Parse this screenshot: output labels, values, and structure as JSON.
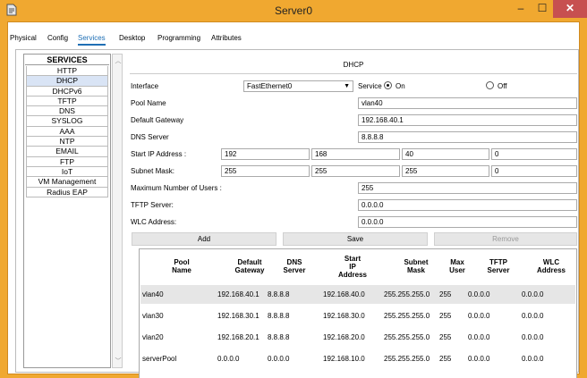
{
  "window": {
    "title": "Server0",
    "min": "–",
    "max": "☐",
    "close": "✕"
  },
  "tabs": [
    "Physical",
    "Config",
    "Services",
    "Desktop",
    "Programming",
    "Attributes"
  ],
  "services": {
    "header": "SERVICES",
    "items": [
      "HTTP",
      "DHCP",
      "DHCPv6",
      "TFTP",
      "DNS",
      "SYSLOG",
      "AAA",
      "NTP",
      "EMAIL",
      "FTP",
      "IoT",
      "VM Management",
      "Radius EAP"
    ],
    "selected": "DHCP"
  },
  "dhcp": {
    "title": "DHCP",
    "interface_label": "Interface",
    "interface_value": "FastEthernet0",
    "service_label": "Service",
    "on_label": "On",
    "off_label": "Off",
    "service_state": "on",
    "pool_name_label": "Pool Name",
    "pool_name": "vlan40",
    "gateway_label": "Default Gateway",
    "gateway": "192.168.40.1",
    "dns_label": "DNS Server",
    "dns": "8.8.8.8",
    "start_ip_label": "Start IP Address :",
    "start_ip": [
      "192",
      "168",
      "40",
      "0"
    ],
    "subnet_label": "Subnet Mask:",
    "subnet": [
      "255",
      "255",
      "255",
      "0"
    ],
    "max_users_label": "Maximum Number of Users :",
    "max_users": "255",
    "tftp_label": "TFTP Server:",
    "tftp": "0.0.0.0",
    "wlc_label": "WLC Address:",
    "wlc": "0.0.0.0",
    "add_label": "Add",
    "save_label": "Save",
    "remove_label": "Remove"
  },
  "table": {
    "headers": [
      [
        "Pool",
        "Name"
      ],
      [
        "Default",
        "Gateway"
      ],
      [
        "DNS",
        "Server"
      ],
      [
        "Start",
        "IP",
        "Address"
      ],
      [
        "Subnet",
        "Mask"
      ],
      [
        "Max",
        "User"
      ],
      [
        "TFTP",
        "Server"
      ],
      [
        "WLC",
        "Address"
      ]
    ],
    "rows": [
      [
        "vlan40",
        "192.168.40.1",
        "8.8.8.8",
        "192.168.40.0",
        "255.255.255.0",
        "255",
        "0.0.0.0",
        "0.0.0.0"
      ],
      [
        "vlan30",
        "192.168.30.1",
        "8.8.8.8",
        "192.168.30.0",
        "255.255.255.0",
        "255",
        "0.0.0.0",
        "0.0.0.0"
      ],
      [
        "vlan20",
        "192.168.20.1",
        "8.8.8.8",
        "192.168.20.0",
        "255.255.255.0",
        "255",
        "0.0.0.0",
        "0.0.0.0"
      ],
      [
        "serverPool",
        "0.0.0.0",
        "0.0.0.0",
        "192.168.10.0",
        "255.255.255.0",
        "255",
        "0.0.0.0",
        "0.0.0.0"
      ]
    ],
    "selected_row": 0
  }
}
